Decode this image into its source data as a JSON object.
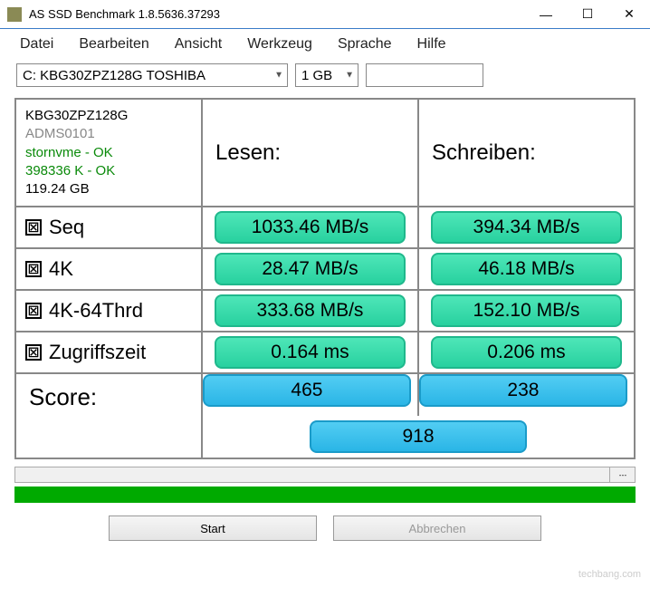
{
  "window": {
    "title": "AS SSD Benchmark 1.8.5636.37293"
  },
  "menu": {
    "datei": "Datei",
    "bearbeiten": "Bearbeiten",
    "ansicht": "Ansicht",
    "werkzeug": "Werkzeug",
    "sprache": "Sprache",
    "hilfe": "Hilfe"
  },
  "toolbar": {
    "drive": "C: KBG30ZPZ128G TOSHIBA",
    "size": "1 GB"
  },
  "drive_info": {
    "model": "KBG30ZPZ128G",
    "firmware": "ADMS0101",
    "driver": "stornvme - OK",
    "align": "398336 K - OK",
    "capacity": "119.24 GB"
  },
  "headers": {
    "read": "Lesen:",
    "write": "Schreiben:"
  },
  "tests": {
    "seq": {
      "label": "Seq",
      "read": "1033.46 MB/s",
      "write": "394.34 MB/s"
    },
    "4k": {
      "label": "4K",
      "read": "28.47 MB/s",
      "write": "46.18 MB/s"
    },
    "4k64": {
      "label": "4K-64Thrd",
      "read": "333.68 MB/s",
      "write": "152.10 MB/s"
    },
    "acc": {
      "label": "Zugriffszeit",
      "read": "0.164 ms",
      "write": "0.206 ms"
    }
  },
  "score": {
    "label": "Score:",
    "read": "465",
    "write": "238",
    "total": "918"
  },
  "buttons": {
    "start": "Start",
    "abort": "Abbrechen"
  },
  "watermark": "techbang.com"
}
